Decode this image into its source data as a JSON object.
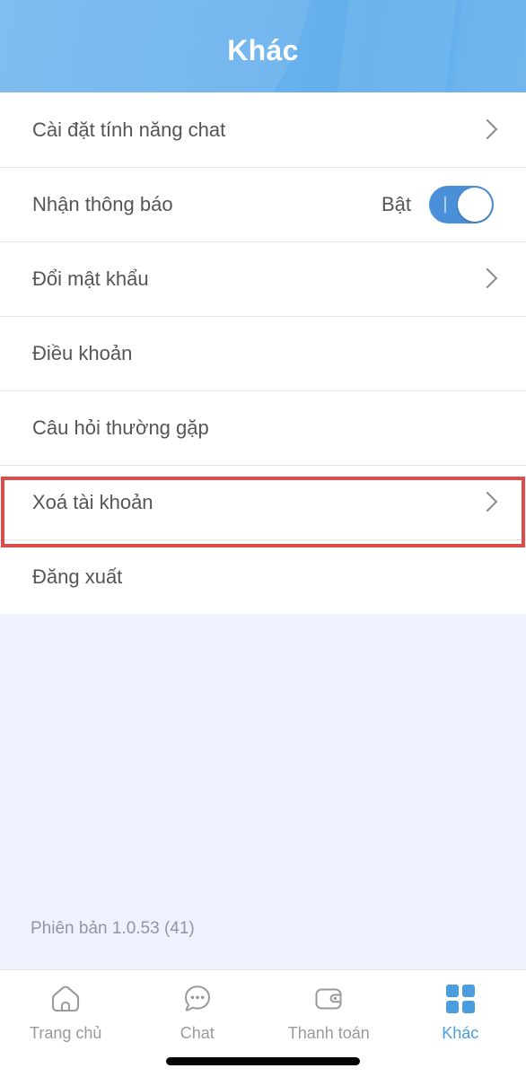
{
  "header": {
    "title": "Khác"
  },
  "list": {
    "rows": [
      {
        "label": "Cài đặt tính năng chat",
        "accessory": "chevron",
        "value": ""
      },
      {
        "label": "Nhận thông báo",
        "accessory": "toggle",
        "value": "Bật",
        "toggle_on": true
      },
      {
        "label": "Đổi mật khẩu",
        "accessory": "chevron",
        "value": ""
      },
      {
        "label": "Điều khoản",
        "accessory": "none",
        "value": ""
      },
      {
        "label": "Câu hỏi thường gặp",
        "accessory": "none",
        "value": ""
      },
      {
        "label": "Xoá tài khoản",
        "accessory": "chevron",
        "value": "",
        "highlighted": true
      },
      {
        "label": "Đăng xuất",
        "accessory": "none",
        "value": ""
      }
    ]
  },
  "footer": {
    "version": "Phiên bản 1.0.53 (41)"
  },
  "tabbar": {
    "tabs": [
      {
        "label": "Trang chủ",
        "icon": "home-icon",
        "active": false
      },
      {
        "label": "Chat",
        "icon": "chat-bubble-icon",
        "active": false
      },
      {
        "label": "Thanh toán",
        "icon": "wallet-icon",
        "active": false
      },
      {
        "label": "Khác",
        "icon": "grid-icon",
        "active": true
      }
    ]
  },
  "colors": {
    "header_blue": "#6cb3ee",
    "accent_blue": "#4a9ee0",
    "toggle_on": "#4a90d9",
    "highlight_red": "#dd4b4b",
    "page_background": "#eff2fd",
    "text_primary": "#555555",
    "text_muted": "#9a9a9a"
  }
}
